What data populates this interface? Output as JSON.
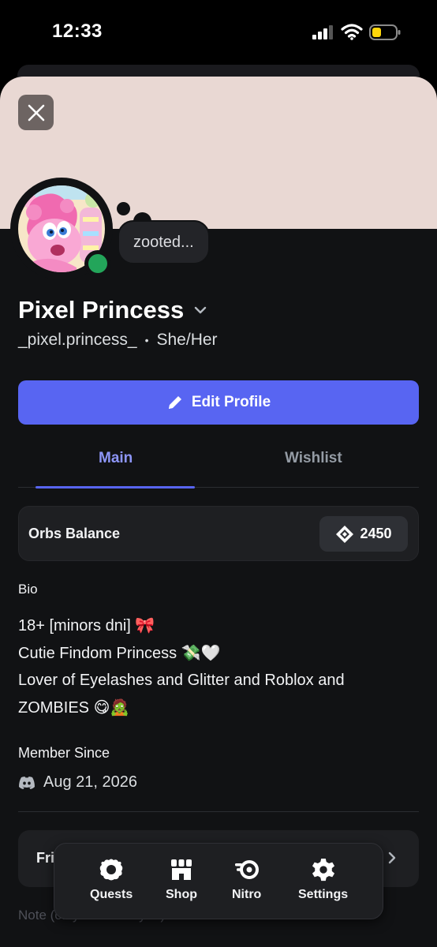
{
  "status_bar": {
    "time": "12:33"
  },
  "profile": {
    "display_name": "Pixel Princess",
    "username": "_pixel.princess_",
    "separator": "•",
    "pronouns": "She/Her",
    "custom_status": "zooted...",
    "online_status_color": "#23a55a",
    "banner_color": "#e9d8d3"
  },
  "actions": {
    "edit_profile_label": "Edit Profile"
  },
  "tabs": [
    {
      "label": "Main",
      "active": true
    },
    {
      "label": "Wishlist",
      "active": false
    }
  ],
  "orbs": {
    "label": "Orbs Balance",
    "value": "2450"
  },
  "bio": {
    "heading": "Bio",
    "line1_text": "18+ [minors dni]",
    "line1_emoji": "🎀",
    "line2_text": "Cutie Findom Princess",
    "line2_emoji": "💸🤍",
    "line3_text": "Lover of Eyelashes and Glitter and Roblox and",
    "line4_text": "ZOMBIES",
    "line4_emoji": "😋🧟"
  },
  "member_since": {
    "heading": "Member Since",
    "date": "Aug 21, 2026"
  },
  "friends": {
    "label": "Fri"
  },
  "note": {
    "placeholder": "Note (only visible to you)"
  },
  "bottom_nav": [
    {
      "label": "Quests",
      "icon": "quests-icon"
    },
    {
      "label": "Shop",
      "icon": "shop-icon"
    },
    {
      "label": "Nitro",
      "icon": "nitro-icon"
    },
    {
      "label": "Settings",
      "icon": "gear-icon"
    }
  ],
  "colors": {
    "accent": "#5865f2",
    "tab_active": "#8d95f7",
    "background": "#111214"
  }
}
